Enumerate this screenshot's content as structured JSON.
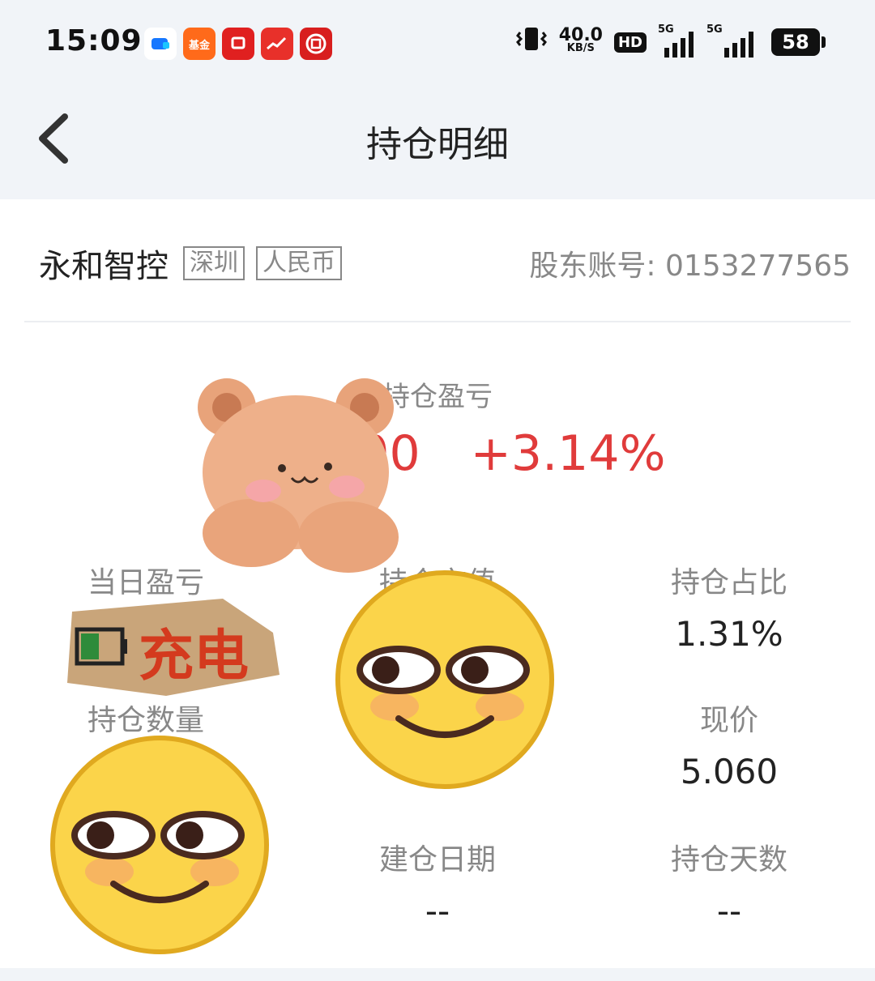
{
  "status_bar": {
    "time": "15:09",
    "notifications": [
      "app-icon-blue",
      "fund-app-icon",
      "securities-app-icon",
      "stock-app-icon",
      "bank-app-icon"
    ],
    "fund_app_label": "基金",
    "net_speed_value": "40.0",
    "net_speed_unit": "KB/S",
    "hd_label": "HD",
    "signal_1_tag": "5G",
    "signal_2_tag": "5G",
    "battery": "58"
  },
  "header": {
    "title": "持仓明细",
    "back_icon": "chevron-left-icon"
  },
  "stock": {
    "name": "永和智控",
    "market_tag": "深圳",
    "currency_tag": "人民币",
    "account_label": "股东账号:",
    "account_number": "0153277565"
  },
  "position_pl": {
    "label": "持仓盈亏",
    "amount": "+154.00",
    "percent": "+3.14%",
    "color": "#e03b3b"
  },
  "metrics": {
    "daily_pl": {
      "label": "当日盈亏",
      "value": ""
    },
    "market_value": {
      "label": "持仓市值",
      "value": ""
    },
    "position_ratio": {
      "label": "持仓占比",
      "value": "1.31%"
    },
    "quantity": {
      "label": "持仓数量",
      "value": ""
    },
    "price": {
      "label": "现价",
      "value": "5.060"
    },
    "open_date": {
      "label": "建仓日期",
      "value": "--"
    },
    "hold_days": {
      "label": "持仓天数",
      "value": "--"
    }
  },
  "stickers": {
    "bear": "teddy-bear-sticker",
    "charge_text": "充电",
    "smirk": "smirk-face-sticker"
  }
}
